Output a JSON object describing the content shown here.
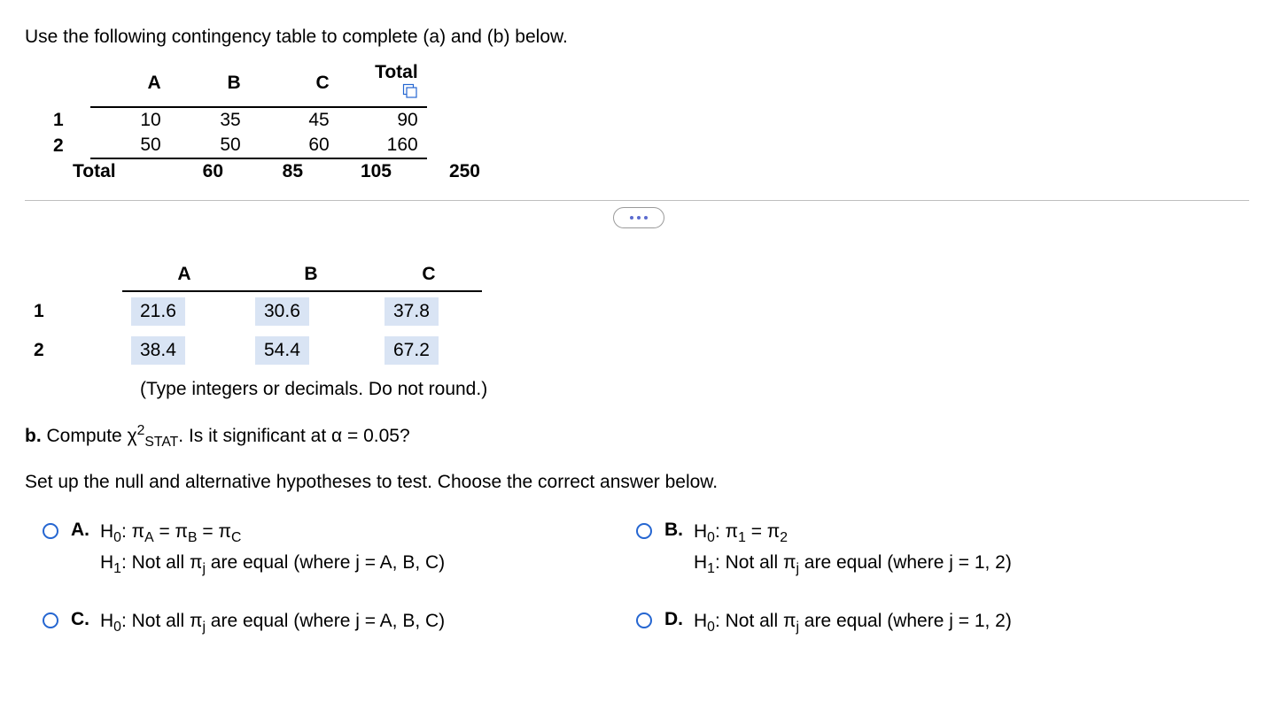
{
  "prompt": "Use the following contingency table to complete (a) and (b) below.",
  "contingency": {
    "headers": {
      "A": "A",
      "B": "B",
      "C": "C",
      "Total": "Total"
    },
    "rows": [
      {
        "label": "1",
        "A": "10",
        "B": "35",
        "C": "45",
        "T": "90"
      },
      {
        "label": "2",
        "A": "50",
        "B": "50",
        "C": "60",
        "T": "160"
      },
      {
        "label": "Total",
        "A": "60",
        "B": "85",
        "C": "105",
        "T": "250"
      }
    ]
  },
  "expected": {
    "headers": {
      "A": "A",
      "B": "B",
      "C": "C"
    },
    "rows": [
      {
        "label": "1",
        "A": "21.6",
        "B": "30.6",
        "C": "37.8"
      },
      {
        "label": "2",
        "A": "38.4",
        "B": "54.4",
        "C": "67.2"
      }
    ]
  },
  "hint": "(Type integers or decimals. Do not round.)",
  "partb": {
    "prefix": "b.",
    "compute": "Compute ",
    "chi": "χ",
    "stat": "STAT",
    "rest": ". Is it significant at α = 0.05?"
  },
  "setup_instr": "Set up the null and alternative hypotheses to test. Choose the correct answer below.",
  "choices": {
    "A": {
      "label": "A.",
      "h0_pre": "H",
      "h0_sub": "0",
      "h0_mid": ": π",
      "h0_subA": "A",
      "h0_eq1": " = π",
      "h0_subB": "B",
      "h0_eq2": " = π",
      "h0_subC": "C",
      "h1_pre": "H",
      "h1_sub": "1",
      "h1_text": ": Not all π",
      "h1_jsub": "j",
      "h1_rest": " are equal (where j = A, B, C)"
    },
    "B": {
      "label": "B.",
      "h0_pre": "H",
      "h0_sub": "0",
      "h0_mid": ": π",
      "h0_sub1": "1",
      "h0_eq": " = π",
      "h0_sub2": "2",
      "h1_pre": "H",
      "h1_sub": "1",
      "h1_text": ": Not all π",
      "h1_jsub": "j",
      "h1_rest": " are equal (where j = 1, 2)"
    },
    "C": {
      "label": "C.",
      "h0_pre": "H",
      "h0_sub": "0",
      "h0_text": ": Not all π",
      "h0_jsub": "j",
      "h0_rest": " are equal (where j = A, B, C)"
    },
    "D": {
      "label": "D.",
      "h0_pre": "H",
      "h0_sub": "0",
      "h0_text": ": Not all π",
      "h0_jsub": "j",
      "h0_rest": " are equal (where j = 1, 2)"
    }
  }
}
